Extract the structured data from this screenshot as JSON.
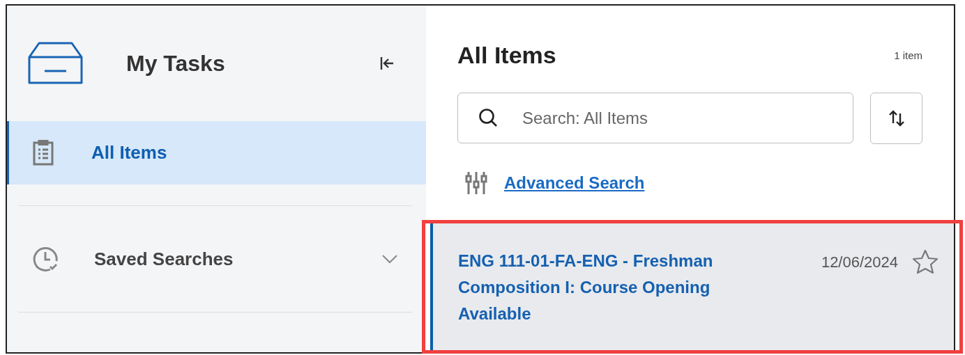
{
  "sidebar": {
    "title": "My Tasks",
    "items": [
      {
        "kind": "link",
        "label": "All Items",
        "selected": true
      },
      {
        "kind": "group",
        "label": "Saved Searches",
        "selected": false,
        "expanded": false
      }
    ]
  },
  "main": {
    "title": "All Items",
    "count": "1 item",
    "search": {
      "placeholder": "Search: All Items"
    },
    "advanced_search": "Advanced Search",
    "items": [
      {
        "title": "ENG 111-01-FA-ENG - Freshman Composition I: Course Opening Available",
        "date": "12/06/2024",
        "starred": false,
        "selected": true,
        "highlighted": true
      }
    ]
  }
}
